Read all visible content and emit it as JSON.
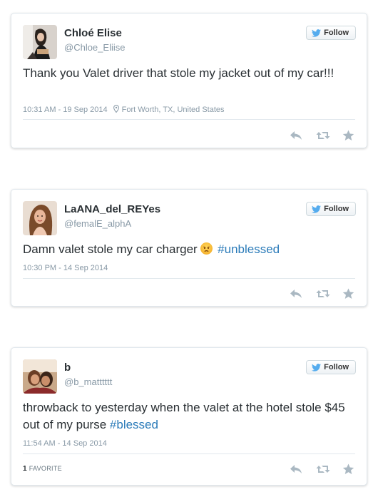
{
  "follow_label": "Follow",
  "colors": {
    "hashtag": "#2b7bb9",
    "meta": "#8899a6",
    "border": "#e1e8ed"
  },
  "tweets": [
    {
      "name": "Chloé Elise",
      "handle": "@Chloe_Eliise",
      "text": "Thank you Valet driver that stole my jacket out of my car!!!",
      "timestamp": "10:31 AM - 19 Sep 2014",
      "location": "Fort Worth, TX, United States"
    },
    {
      "name": "LaANA_del_REYes",
      "handle": "@femalE_alphA",
      "text": "Damn valet stole my car charger",
      "emoji": "angry-face-emoji",
      "hashtag": "#unblessed",
      "timestamp": "10:30 PM - 14 Sep 2014"
    },
    {
      "name": "b",
      "handle": "@b_matttttt",
      "text": "throwback to yesterday when the valet at the hotel stole $45 out of my purse",
      "hashtag": "#blessed",
      "timestamp": "11:54 AM - 14 Sep 2014",
      "favorites_count": "1",
      "favorites_label": "FAVORITE"
    }
  ]
}
